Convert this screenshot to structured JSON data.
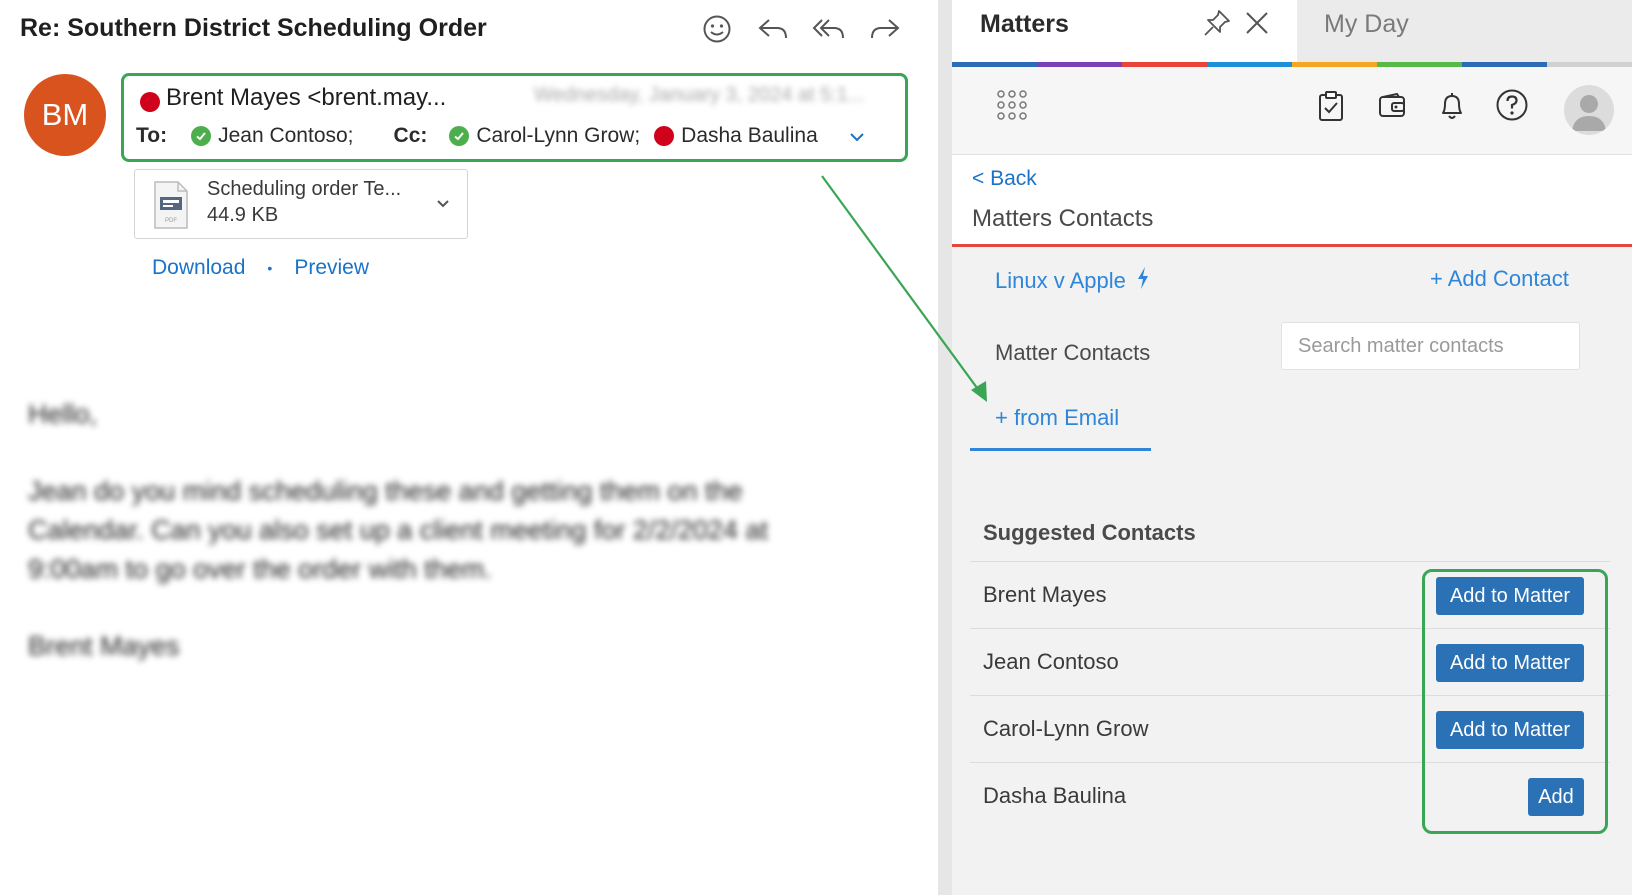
{
  "email": {
    "subject": "Re: Southern District Scheduling Order",
    "actions": [
      "smiley-icon",
      "reply-icon",
      "reply-all-icon",
      "forward-icon"
    ],
    "avatar_initials": "BM",
    "sender": "Brent Mayes <brent.may...",
    "date": "Wednesday, January 3, 2024 at 5:1...",
    "to_label": "To:",
    "to": [
      {
        "name": "Jean Contoso;",
        "status": "available"
      }
    ],
    "cc_label": "Cc:",
    "cc": [
      {
        "name": "Carol-Lynn Grow;",
        "status": "available"
      },
      {
        "name": "Dasha Baulina",
        "status": "busy"
      }
    ],
    "attachment": {
      "name": "Scheduling order Te...",
      "size": "44.9 KB"
    },
    "download_label": "Download",
    "separator": "•",
    "preview_label": "Preview",
    "body": [
      "Hello,",
      "Jean do you mind scheduling these and getting them on the Calendar. Can you also set up a client meeting for 2/2/2024 at 9:00am to go over the order with them.",
      "Brent Mayes"
    ]
  },
  "pane": {
    "tabs": {
      "active": "Matters",
      "other": "My Day"
    },
    "rainbow_colors": [
      "#2d6cb5",
      "#7b3fb8",
      "#e8443a",
      "#1e90d8",
      "#f5a623",
      "#57b947",
      "#2d6cb5",
      "#d0d0d0"
    ],
    "back_label": "< Back",
    "title": "Matters Contacts",
    "matter_name": "Linux v Apple",
    "add_contact_label": "+ Add Contact",
    "matter_contacts_label": "Matter Contacts",
    "search_placeholder": "Search matter contacts",
    "from_email_label": "+ from Email",
    "suggested_title": "Suggested Contacts",
    "suggested": [
      {
        "name": "Brent Mayes",
        "button": "Add to Matter"
      },
      {
        "name": "Jean Contoso",
        "button": "Add to Matter"
      },
      {
        "name": "Carol-Lynn Grow",
        "button": "Add to Matter"
      },
      {
        "name": "Dasha Baulina",
        "button": "Add"
      }
    ]
  },
  "colors": {
    "highlight": "#3aa655",
    "link": "#2f86d8",
    "button": "#2b71b5",
    "avatar": "#d9531e",
    "accent_line": "#e4463b"
  }
}
